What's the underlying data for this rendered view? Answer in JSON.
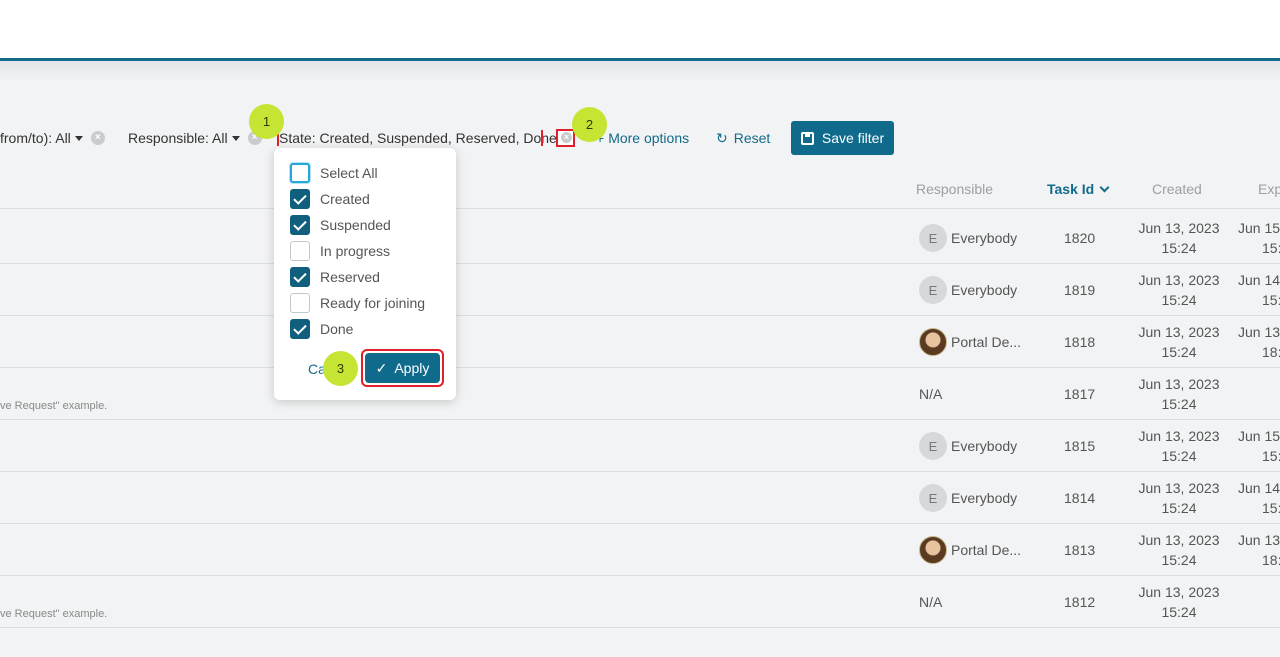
{
  "filters": {
    "date_range": "from/to): All",
    "responsible": "Responsible: All",
    "state": "State: Created, Suspended, Reserved, Done"
  },
  "toolbar": {
    "more_options": "More options",
    "reset": "Reset",
    "save_filter": "Save filter"
  },
  "badges": [
    "1",
    "2",
    "3"
  ],
  "table": {
    "headers": [
      "Responsible",
      "Task Id",
      "Created",
      "Exp"
    ],
    "rows": [
      {
        "responsible": "Everybody",
        "avatar": "E",
        "task_id": "1820",
        "created_date": "Jun 13, 2023",
        "created_time": "15:24",
        "exp_date": "Jun 15",
        "exp_time": "15:",
        "desc": ""
      },
      {
        "responsible": "Everybody",
        "avatar": "E",
        "task_id": "1819",
        "created_date": "Jun 13, 2023",
        "created_time": "15:24",
        "exp_date": "Jun 14",
        "exp_time": "15:",
        "desc": ""
      },
      {
        "responsible": "Portal De...",
        "avatar": "",
        "task_id": "1818",
        "created_date": "Jun 13, 2023",
        "created_time": "15:24",
        "exp_date": "Jun 13",
        "exp_time": "18:",
        "desc": ""
      },
      {
        "responsible": "N/A",
        "avatar": "",
        "task_id": "1817",
        "created_date": "Jun 13, 2023",
        "created_time": "15:24",
        "exp_date": "",
        "exp_time": "",
        "desc": "ve Request\" example."
      },
      {
        "responsible": "Everybody",
        "avatar": "E",
        "task_id": "1815",
        "created_date": "Jun 13, 2023",
        "created_time": "15:24",
        "exp_date": "Jun 15",
        "exp_time": "15:",
        "desc": ""
      },
      {
        "responsible": "Everybody",
        "avatar": "E",
        "task_id": "1814",
        "created_date": "Jun 13, 2023",
        "created_time": "15:24",
        "exp_date": "Jun 14",
        "exp_time": "15:",
        "desc": ""
      },
      {
        "responsible": "Portal De...",
        "avatar": "",
        "task_id": "1813",
        "created_date": "Jun 13, 2023",
        "created_time": "15:24",
        "exp_date": "Jun 13",
        "exp_time": "18:",
        "desc": ""
      },
      {
        "responsible": "N/A",
        "avatar": "",
        "task_id": "1812",
        "created_date": "Jun 13, 2023",
        "created_time": "15:24",
        "exp_date": "",
        "exp_time": "",
        "desc": "ve Request\" example."
      }
    ]
  },
  "dropdown": {
    "options": [
      {
        "label": "Select All",
        "checked": false
      },
      {
        "label": "Created",
        "checked": true
      },
      {
        "label": "Suspended",
        "checked": true
      },
      {
        "label": "In progress",
        "checked": false
      },
      {
        "label": "Reserved",
        "checked": true
      },
      {
        "label": "Ready for joining",
        "checked": false
      },
      {
        "label": "Done",
        "checked": true
      }
    ],
    "cancel": "Ca",
    "apply": "Apply"
  },
  "colors": {
    "accent": "#0f6a8c",
    "highlight": "#e0202a",
    "badge": "#c6e433"
  }
}
